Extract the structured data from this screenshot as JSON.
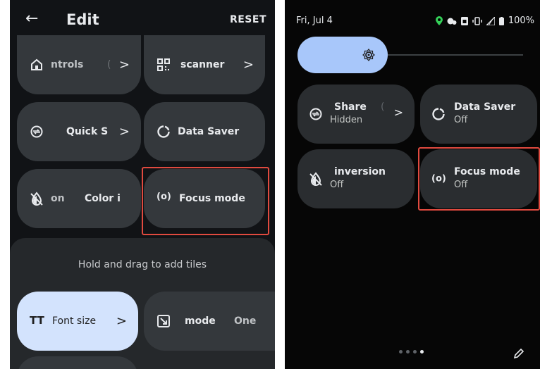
{
  "left": {
    "back_glyph": "←",
    "title": "Edit",
    "reset": "RESET",
    "tiles": [
      {
        "label": "ntrols",
        "extra": "(",
        "chev": ">"
      },
      {
        "label": "scanner",
        "chev": ">"
      },
      {
        "label": "Quick S",
        "chev": ">"
      },
      {
        "label": "Data Saver"
      },
      {
        "label_a": "on",
        "label_b": "Color i"
      },
      {
        "label": "Focus mode"
      }
    ],
    "hint": "Hold and drag to add tiles",
    "add_tiles": [
      {
        "label": "Font size",
        "chev": ">"
      },
      {
        "label": "mode",
        "extra": "One"
      }
    ]
  },
  "right": {
    "date": "Fri, Jul 4",
    "battery": "100%",
    "tiles": [
      {
        "title": "Share",
        "extra": "(",
        "subtitle": "Hidden",
        "chev": ">"
      },
      {
        "title": "Data Saver",
        "subtitle": "Off"
      },
      {
        "title": "inversion",
        "subtitle": "Off"
      },
      {
        "title": "Focus mode",
        "subtitle": "Off"
      }
    ]
  },
  "colors": {
    "accent": "#a8c7fa",
    "highlight": "#e04a3f"
  }
}
